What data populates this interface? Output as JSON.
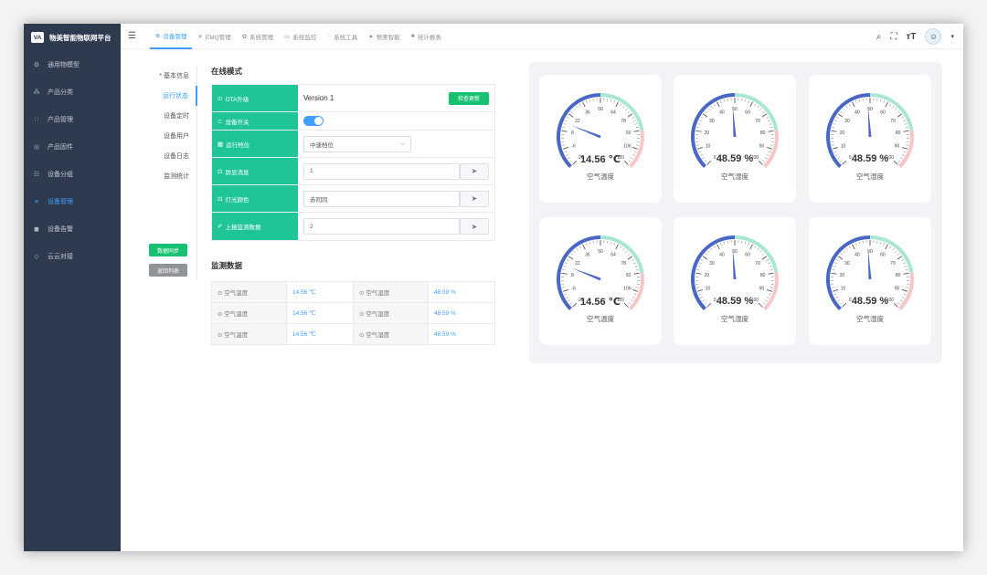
{
  "brand": {
    "logo": "VA",
    "title": "物美智能物联网平台"
  },
  "sidebar": {
    "items": [
      {
        "icon": "gear-icon",
        "glyph": "⚙",
        "label": "通用物模型"
      },
      {
        "icon": "tree-icon",
        "glyph": "⁂",
        "label": "产品分类"
      },
      {
        "icon": "grid-icon",
        "glyph": "∷",
        "label": "产品管理"
      },
      {
        "icon": "chip-icon",
        "glyph": "◎",
        "label": "产品固件"
      },
      {
        "icon": "group-icon",
        "glyph": "☷",
        "label": "设备分组"
      },
      {
        "icon": "list-icon",
        "glyph": "≡",
        "label": "设备管理",
        "active": true
      },
      {
        "icon": "bell-icon",
        "glyph": "◼",
        "label": "设备告警"
      },
      {
        "icon": "cloud-icon",
        "glyph": "◇",
        "label": "云云对接"
      }
    ]
  },
  "topbar": {
    "tabs": [
      {
        "icon": "device-icon",
        "glyph": "⊕",
        "label": "设备管理",
        "active": true
      },
      {
        "icon": "emq-icon",
        "glyph": "✕",
        "label": "EMQ管理"
      },
      {
        "icon": "settings-icon",
        "glyph": "✿",
        "label": "系统管理"
      },
      {
        "icon": "monitor-icon",
        "glyph": "▭",
        "label": "系统监控"
      },
      {
        "icon": "tools-icon",
        "glyph": "◌",
        "label": "系统工具"
      },
      {
        "icon": "send-icon",
        "glyph": "➤",
        "label": "物美智能"
      },
      {
        "icon": "chart-icon",
        "glyph": "♣",
        "label": "统计报表"
      }
    ]
  },
  "subnav": {
    "items": [
      "* 基本信息",
      "运行状态",
      "设备定时",
      "设备用户",
      "设备日志",
      "监测统计"
    ],
    "active_index": 1,
    "sync_button": "数据同步",
    "back_button": "返回列表"
  },
  "online": {
    "title": "在线模式",
    "ota_label": "OTA升级",
    "ota_version": "Version 1",
    "ota_check": "检查更新",
    "switch_label": "设备开关",
    "switch_on": true,
    "gear_label": "运行档位",
    "gear_value": "中速档位",
    "screen_label": "屏显消息",
    "screen_value": "1",
    "light_label": "灯光颜色",
    "light_value": "赤同同",
    "report_label": "上报监测数据",
    "report_value": "2"
  },
  "monitor": {
    "title": "监测数据",
    "rows": [
      {
        "l1": "空气温度",
        "v1": "14.56 ℃",
        "l2": "空气湿度",
        "v2": "48.59 %"
      },
      {
        "l1": "空气温度",
        "v1": "14.56 ℃",
        "l2": "空气湿度",
        "v2": "48.59 %"
      },
      {
        "l1": "空气温度",
        "v1": "14.56 ℃",
        "l2": "空气湿度",
        "v2": "48.59 %"
      }
    ]
  },
  "gauges": [
    {
      "value_text": "14.56 ℃",
      "name": "空气温度",
      "min": -20,
      "max": 120,
      "value": 14.56,
      "labels": [
        "-20",
        "-6",
        "8",
        "22",
        "36",
        "50",
        "64",
        "78",
        "92",
        "106",
        "120"
      ]
    },
    {
      "value_text": "48.59 %",
      "name": "空气湿度",
      "min": 0,
      "max": 100,
      "value": 48.59,
      "labels": [
        "0",
        "10",
        "20",
        "30",
        "40",
        "50",
        "60",
        "70",
        "80",
        "90",
        "100"
      ]
    },
    {
      "value_text": "48.59 %",
      "name": "空气湿度",
      "min": 0,
      "max": 100,
      "value": 48.59,
      "labels": [
        "0",
        "10",
        "20",
        "30",
        "40",
        "50",
        "60",
        "70",
        "80",
        "90",
        "100"
      ]
    },
    {
      "value_text": "14.56 ℃",
      "name": "空气温度",
      "min": -20,
      "max": 120,
      "value": 14.56,
      "labels": [
        "-20",
        "-6",
        "8",
        "22",
        "36",
        "50",
        "64",
        "78",
        "92",
        "106",
        "120"
      ]
    },
    {
      "value_text": "48.59 %",
      "name": "空气湿度",
      "min": 0,
      "max": 100,
      "value": 48.59,
      "labels": [
        "0",
        "10",
        "20",
        "30",
        "40",
        "50",
        "60",
        "70",
        "80",
        "90",
        "100"
      ]
    },
    {
      "value_text": "48.59 %",
      "name": "空气湿度",
      "min": 0,
      "max": 100,
      "value": 48.59,
      "labels": [
        "0",
        "10",
        "20",
        "30",
        "40",
        "50",
        "60",
        "70",
        "80",
        "90",
        "100"
      ]
    }
  ],
  "colors": {
    "accent": "#409eff",
    "green": "#1fc597",
    "gauge_low": "#4a67c6",
    "gauge_mid": "#a9e6d4",
    "gauge_high": "#f7c6c6"
  }
}
